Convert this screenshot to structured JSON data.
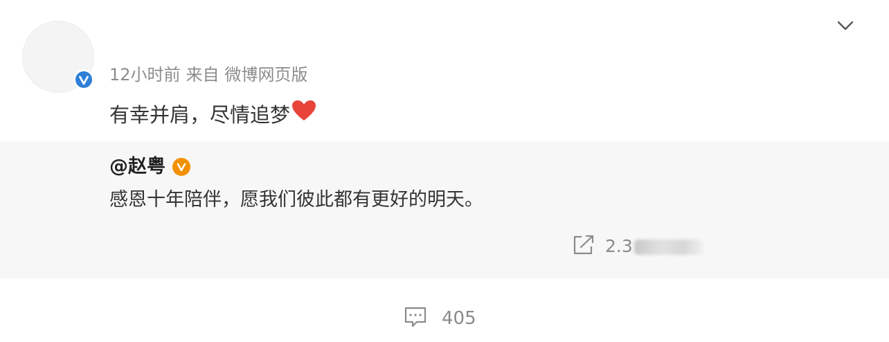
{
  "post": {
    "time": "12小时前",
    "source_prefix": "来自",
    "source": "微博网页版",
    "text": "有幸并肩，尽情追梦"
  },
  "repost": {
    "author": "@赵粤",
    "text": "感恩十年陪伴，愿我们彼此都有更好的明天。",
    "share_count": "2.3"
  },
  "footer": {
    "comment_count": "405"
  },
  "icons": {
    "expand": "chevron-down-icon",
    "verified": "blue-verified-badge-icon",
    "gold_verified": "orange-verified-badge-icon",
    "heart": "red-heart-icon",
    "share": "share-icon",
    "comment": "comment-icon"
  },
  "colors": {
    "gold_v": "#f29100",
    "blue_v": "#2f80d6",
    "heart": "#e8443a",
    "repost_bg": "#f7f7f7"
  }
}
